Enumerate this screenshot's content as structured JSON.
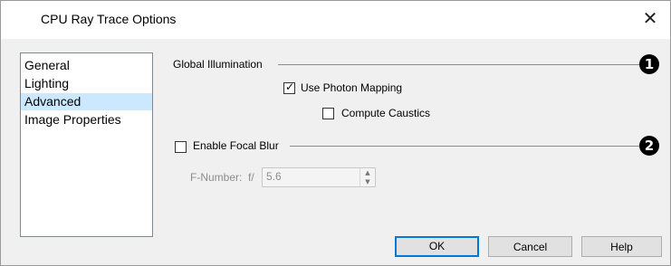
{
  "window": {
    "title": "CPU Ray Trace Options",
    "close_glyph": "✕"
  },
  "sidebar": {
    "items": [
      {
        "label": "General",
        "selected": false
      },
      {
        "label": "Lighting",
        "selected": false
      },
      {
        "label": "Advanced",
        "selected": true
      },
      {
        "label": "Image Properties",
        "selected": false
      }
    ]
  },
  "global_illumination": {
    "label": "Global Illumination",
    "callout": "1",
    "use_photon_mapping": {
      "label": "Use Photon Mapping",
      "checked": true
    },
    "compute_caustics": {
      "label": "Compute Caustics",
      "checked": false
    }
  },
  "focal_blur": {
    "label": "Enable Focal Blur",
    "checked": false,
    "callout": "2",
    "f_number_label": "F-Number:",
    "f_prefix": "f/",
    "f_value": "5.6"
  },
  "buttons": {
    "ok": "OK",
    "cancel": "Cancel",
    "help": "Help"
  },
  "icons": {
    "check": "check-icon",
    "spin_up": "caret-up-icon",
    "spin_down": "caret-down-icon"
  },
  "colors": {
    "selection": "#cce8ff",
    "default_button_border": "#0078d7",
    "disabled_text": "#8d8d8d"
  }
}
